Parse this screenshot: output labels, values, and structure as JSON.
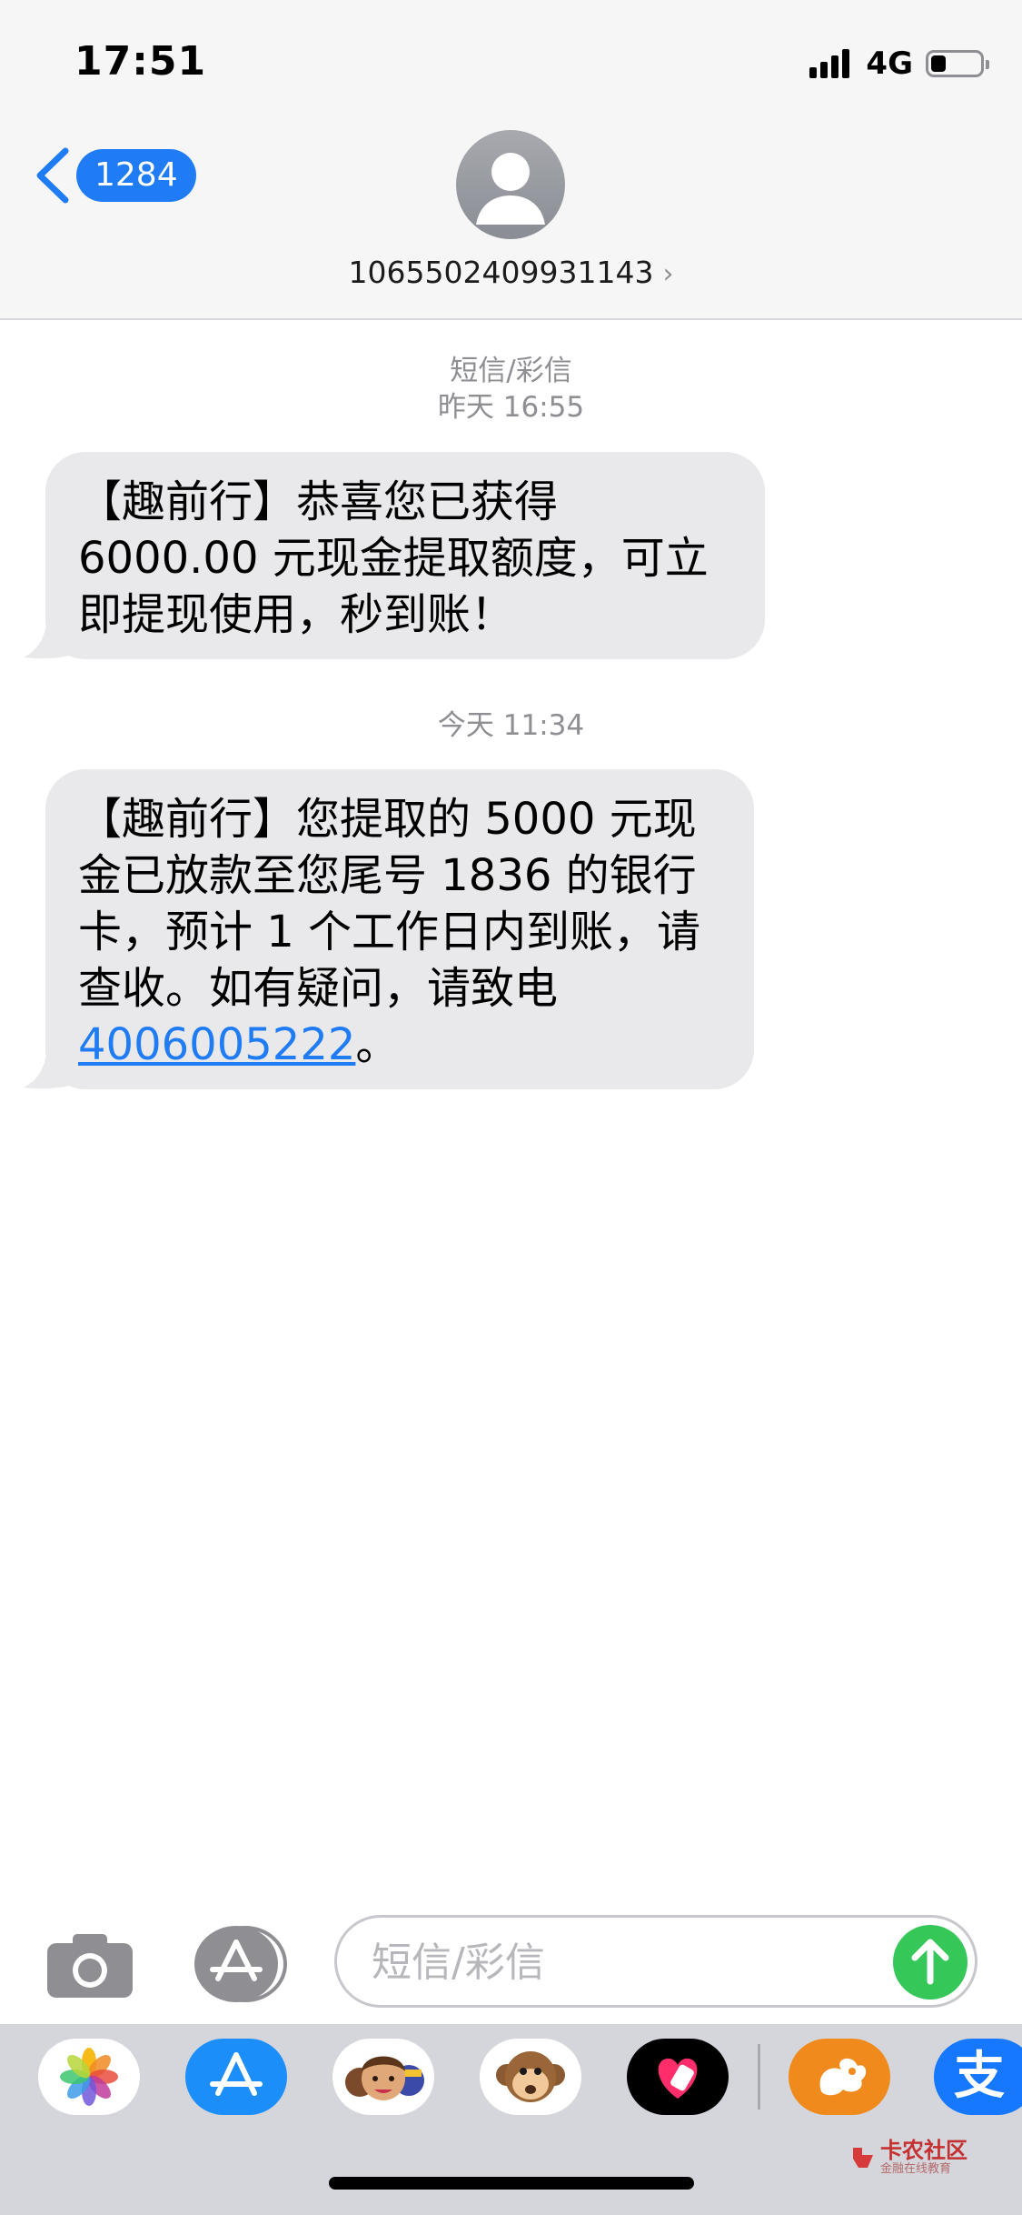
{
  "status_bar": {
    "time": "17:51",
    "network": "4G",
    "signal_bars": 4,
    "battery_level": 0.3
  },
  "nav": {
    "back_label": "1284",
    "contact_number": "1065502409931143",
    "contact_chevron": "›"
  },
  "conversation": {
    "meta1": {
      "service": "短信/彩信",
      "time": "昨天 16:55"
    },
    "message1": {
      "lines": [
        "【趣前行】恭喜您已获得",
        "6000.00 元现金提取额度，可立",
        "即提现使用，秒到账！"
      ]
    },
    "meta2": {
      "time": "今天 11:34"
    },
    "message2": {
      "lines": [
        "【趣前行】您提取的 5000 元现",
        "金已放款至您尾号 1836 的银行",
        "卡，预计 1 个工作日内到账，请",
        "查收。如有疑问，请致电"
      ],
      "phone": "4006005222",
      "suffix": "。"
    }
  },
  "compose": {
    "placeholder": "短信/彩信",
    "camera_icon": "camera-icon",
    "apps_icon": "app-store-icon",
    "send_icon": "arrow-up-icon"
  },
  "app_drawer": {
    "apps": [
      "photos-icon",
      "app-store-icon",
      "memoji-icon",
      "monkey-animoji-icon",
      "digital-touch-icon",
      "uc-browser-icon",
      "alipay-icon"
    ],
    "alipay_glyph": "支"
  },
  "watermark": {
    "title": "卡农社区",
    "subtitle": "金融在线教育"
  },
  "colors": {
    "accent_blue": "#1f7cf5",
    "send_green": "#36c759",
    "bubble_gray": "#e9e9eb"
  }
}
